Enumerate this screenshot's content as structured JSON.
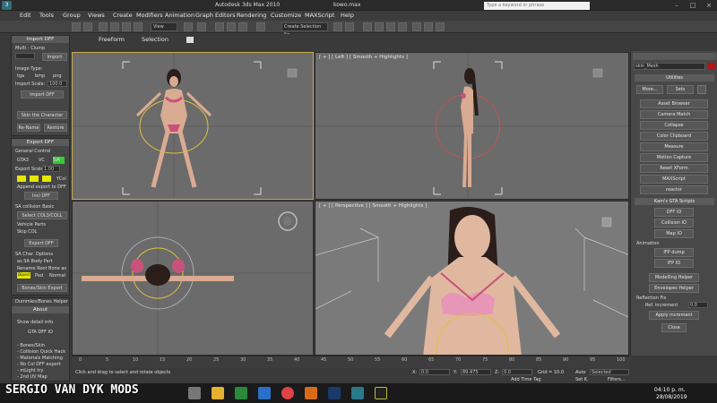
{
  "window": {
    "title": "Autodesk 3ds Max  2010",
    "file": "kowo.max",
    "search_placeholder": "Type a keyword or phrase"
  },
  "menu": [
    "Edit",
    "Tools",
    "Group",
    "Views",
    "Create",
    "Modifiers",
    "Animation",
    "Graph Editors",
    "Rendering",
    "Customize",
    "MAXScript",
    "Help"
  ],
  "toolbar": {
    "view_dropdown": "View",
    "selection_set": "Create Selection Se"
  },
  "ribbon": {
    "tabs": [
      "Freeform",
      "Selection"
    ]
  },
  "import_panel": {
    "title": "Import DFF",
    "multi_clump": "Multi - Clump",
    "import_button": "Import",
    "image_type": "Image Type:",
    "formats": [
      "tga",
      "bmp",
      "png"
    ],
    "import_scale": "Import Scale:",
    "import_scale_value": "100.0",
    "import_dff": "Import DFF",
    "skin_character": "Skin the Character",
    "rename": "Re-Name",
    "restore": "Restore"
  },
  "export_panel": {
    "title": "Export DFF",
    "general_control": "General Control",
    "gta_options": [
      "GTA3",
      "VC",
      "SA"
    ],
    "export_scale": "Export Scale:",
    "export_scale_value": "1.00",
    "ycol": "YCol",
    "append": "Append export to DFF",
    "incl_dff": "Incl DFF",
    "collision_title": "SA collision Basic",
    "select_col": "Select COL3/COLL",
    "vehicle_parts": "Vehicle Parts",
    "skip_col": "Skip COL",
    "export_dff": "Export DFF",
    "char_options": "SA Char. Options",
    "sa_body_part": "as SA Body Part",
    "rename_root": "Rename Root Bone as",
    "tags": [
      "Biped",
      "Ped",
      "Normal"
    ],
    "bones_export": "Bones/Skin Export"
  },
  "dummies_panel": {
    "title": "Dummies/Bones Helper",
    "about": "About",
    "show_detail": "Show detail info.",
    "gta_dff": "GTA DFF IO",
    "items": [
      "- Bones/Skin",
      "- Collision Quick Hack",
      "- Materials Matching",
      "- No Col DFF export",
      "- mLight try",
      "- 2nd UV Map"
    ]
  },
  "viewports": {
    "top_left": "",
    "top_right": "[ + ] [ Left ] [ Smooth + Highlights ]",
    "bottom_left": "",
    "bottom_right": "[ + ] [ Perspective ] [ Smooth + Highlights ]"
  },
  "command_panel": {
    "object_name": "skin_Mesh",
    "utilities_title": "Utilities",
    "more": "More...",
    "sets": "Sets",
    "utilities": [
      "Asset Browser",
      "Camera Match",
      "Collapse",
      "Color Clipboard",
      "Measure",
      "Motion Capture",
      "Reset XForm",
      "MAXScript",
      "reactor"
    ],
    "kam_title": "Kam's GTA Scripts",
    "kam_buttons": [
      "DFF IO",
      "Collision IO",
      "Map IO"
    ],
    "animation_label": "Animation",
    "anim_buttons": [
      "IFP dump",
      "IFP IO"
    ],
    "modelling_helper": "Modelling Helper",
    "envelopes_helper": "Envelopes Helper",
    "reflection_fix": "Reflection Fix",
    "ref_increment_label": "Ref. increment",
    "ref_increment_value": "0.0",
    "apply_increment": "Apply increment",
    "close": "Close"
  },
  "timeline": {
    "ticks": [
      "0",
      "5",
      "10",
      "15",
      "20",
      "25",
      "30",
      "35",
      "40",
      "45",
      "50",
      "55",
      "60",
      "65",
      "70",
      "75",
      "80",
      "85",
      "90",
      "95",
      "100"
    ]
  },
  "status": {
    "click_text": "Click and drag to select and rotate objects",
    "x_label": "X:",
    "x_value": "0.0",
    "y_label": "Y:",
    "y_value": "89.475",
    "z_label": "Z:",
    "z_value": "0.0",
    "grid": "Grid = 10.0",
    "auto": "Auto",
    "selected": "Selected",
    "set_key": "Set K.",
    "filters": "Filters...",
    "add_time_tag": "Add Time Tag"
  },
  "taskbar": {
    "time": "04:10 p. m.",
    "date": "28/08/2019"
  },
  "watermark": "SERGIO VAN DYK MODS"
}
